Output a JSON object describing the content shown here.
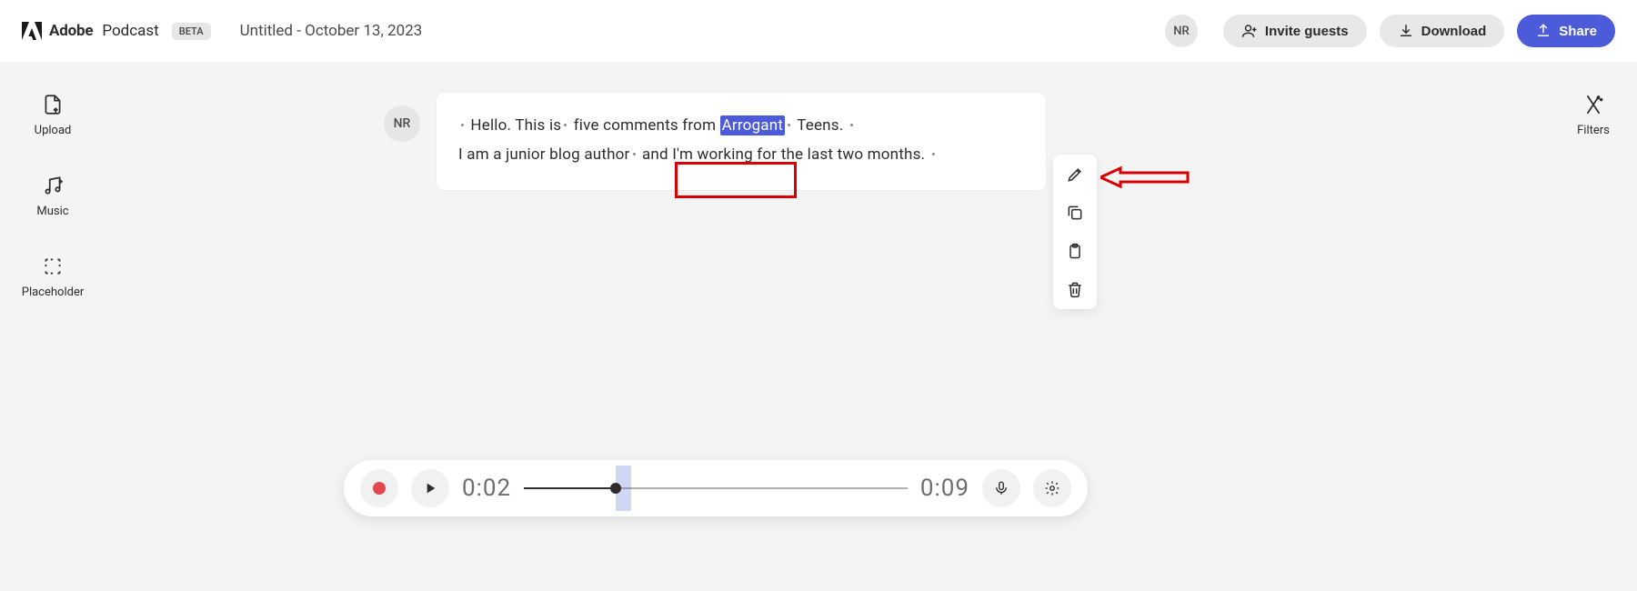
{
  "header": {
    "brand": "Adobe",
    "product": "Podcast",
    "badge": "BETA",
    "title": "Untitled - October 13, 2023",
    "avatar": "NR",
    "invite": "Invite guests",
    "download": "Download",
    "share": "Share"
  },
  "rail_left": {
    "items": [
      {
        "label": "Upload"
      },
      {
        "label": "Music"
      },
      {
        "label": "Placeholder"
      }
    ]
  },
  "rail_right": {
    "filters": "Filters"
  },
  "transcript": {
    "avatar": "NR",
    "line1": {
      "tokens": [
        "Hello.",
        "This",
        "is",
        "five",
        "comments",
        "from",
        "Arrogant",
        "Teens."
      ],
      "dots_before": [
        true,
        false,
        false,
        true,
        false,
        false,
        false,
        true
      ],
      "trailing_dot": true,
      "selected_word": "Arrogant"
    },
    "line2": {
      "tokens": [
        "I",
        "am",
        "a",
        "junior",
        "blog",
        "author",
        "and",
        "I'm",
        "working",
        "for",
        "the",
        "last",
        "two",
        "months."
      ],
      "dots_before": [
        false,
        false,
        false,
        false,
        false,
        false,
        true,
        false,
        false,
        false,
        false,
        false,
        false,
        false
      ],
      "trailing_dot": true
    }
  },
  "toolbar": {
    "items": [
      "edit",
      "copy",
      "clipboard",
      "delete"
    ]
  },
  "player": {
    "current": "0:02",
    "duration": "0:09",
    "progress_pct": 24,
    "sel_start_pct": 24,
    "sel_width_pct": 4
  }
}
